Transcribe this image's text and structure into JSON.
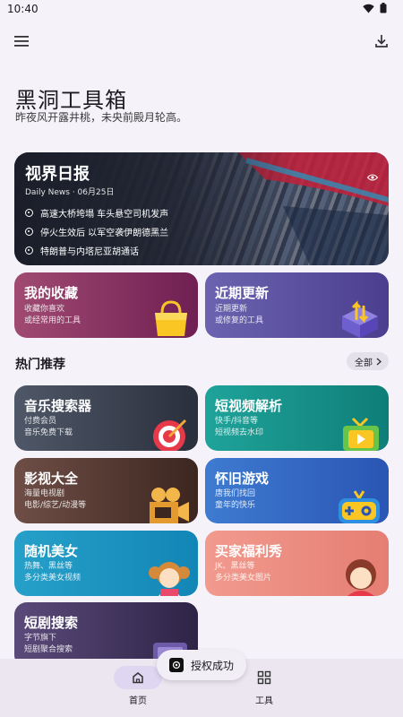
{
  "status": {
    "time": "10:40"
  },
  "header": {
    "title": "黑洞工具箱",
    "subtitle": "昨夜风开露井桃，未央前殿月轮高。"
  },
  "news": {
    "title": "视界日报",
    "date": "Daily News · 06月25日",
    "items": [
      "高速大桥垮塌 车头悬空司机发声",
      "停火生效后 以军空袭伊朗德黑兰",
      "特朗普与内塔尼亚胡通话"
    ]
  },
  "quick": [
    {
      "title": "我的收藏",
      "line1": "收藏你喜欢",
      "line2": "或经常用的工具"
    },
    {
      "title": "近期更新",
      "line1": "近期更新",
      "line2": "或修复的工具"
    }
  ],
  "section": {
    "title": "热门推荐",
    "all_label": "全部"
  },
  "tools": [
    {
      "title": "音乐搜索器",
      "line1": "付费会员",
      "line2": "音乐免费下载"
    },
    {
      "title": "短视频解析",
      "line1": "快手/抖音等",
      "line2": "短视频去水印"
    },
    {
      "title": "影视大全",
      "line1": "海量电视剧",
      "line2": "电影/综艺/动漫等"
    },
    {
      "title": "怀旧游戏",
      "line1": "唐我们找回",
      "line2": "童年的快乐"
    },
    {
      "title": "随机美女",
      "line1": "热舞、黑丝等",
      "line2": "多分类美女视频"
    },
    {
      "title": "买家福利秀",
      "line1": "JK、黑丝等",
      "line2": "多分类美女图片"
    },
    {
      "title": "短剧搜索",
      "line1": "字节旗下",
      "line2": "短剧聚合搜索"
    }
  ],
  "toast": {
    "label": "授权成功"
  },
  "nav": {
    "home": "首页",
    "tools": "工具"
  },
  "colors": {
    "accent": "#dfd6f2",
    "background": "#f6f2fa"
  }
}
